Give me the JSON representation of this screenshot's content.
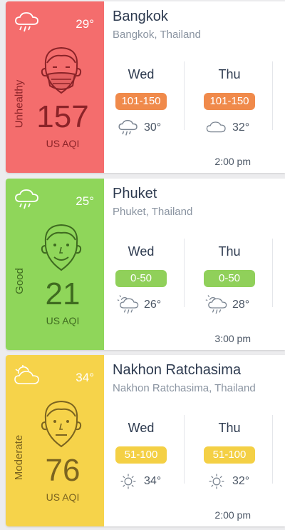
{
  "cards": [
    {
      "panel_color": "#f46d6d",
      "text_color": "#8b2328",
      "temp": "29°",
      "level": "Unhealthy",
      "aqi": "157",
      "unit": "US AQI",
      "face": "mask",
      "panel_icon": "rain-cloud-icon",
      "city": "Bangkok",
      "region": "Bangkok, Thailand",
      "forecast": [
        {
          "day": "Wed",
          "range": "101-150",
          "icon": "rain-cloud-icon",
          "temp": "30°"
        },
        {
          "day": "Thu",
          "range": "101-150",
          "icon": "cloud-icon",
          "temp": "32°"
        }
      ],
      "badge_color": "#f08a4b",
      "time": "2:00 pm"
    },
    {
      "panel_color": "#8fd65a",
      "text_color": "#3f6b20",
      "temp": "25°",
      "level": "Good",
      "aqi": "21",
      "unit": "US AQI",
      "face": "smile",
      "panel_icon": "rain-cloud-icon",
      "city": "Phuket",
      "region": "Phuket, Thailand",
      "forecast": [
        {
          "day": "Wed",
          "range": "0-50",
          "icon": "sun-rain-icon",
          "temp": "26°"
        },
        {
          "day": "Thu",
          "range": "0-50",
          "icon": "sun-rain-icon",
          "temp": "28°"
        }
      ],
      "badge_color": "#90d05a",
      "time": "3:00 pm"
    },
    {
      "panel_color": "#f6d34a",
      "text_color": "#7b6420",
      "temp": "34°",
      "level": "Moderate",
      "aqi": "76",
      "unit": "US AQI",
      "face": "neutral",
      "panel_icon": "sun-cloud-icon",
      "city": "Nakhon Ratchasima",
      "region": "Nakhon Ratchasima, Thailand",
      "forecast": [
        {
          "day": "Wed",
          "range": "51-100",
          "icon": "sun-icon",
          "temp": "34°"
        },
        {
          "day": "Thu",
          "range": "51-100",
          "icon": "sun-icon",
          "temp": "32°"
        }
      ],
      "badge_color": "#f4d045",
      "time": "2:00 pm"
    }
  ]
}
